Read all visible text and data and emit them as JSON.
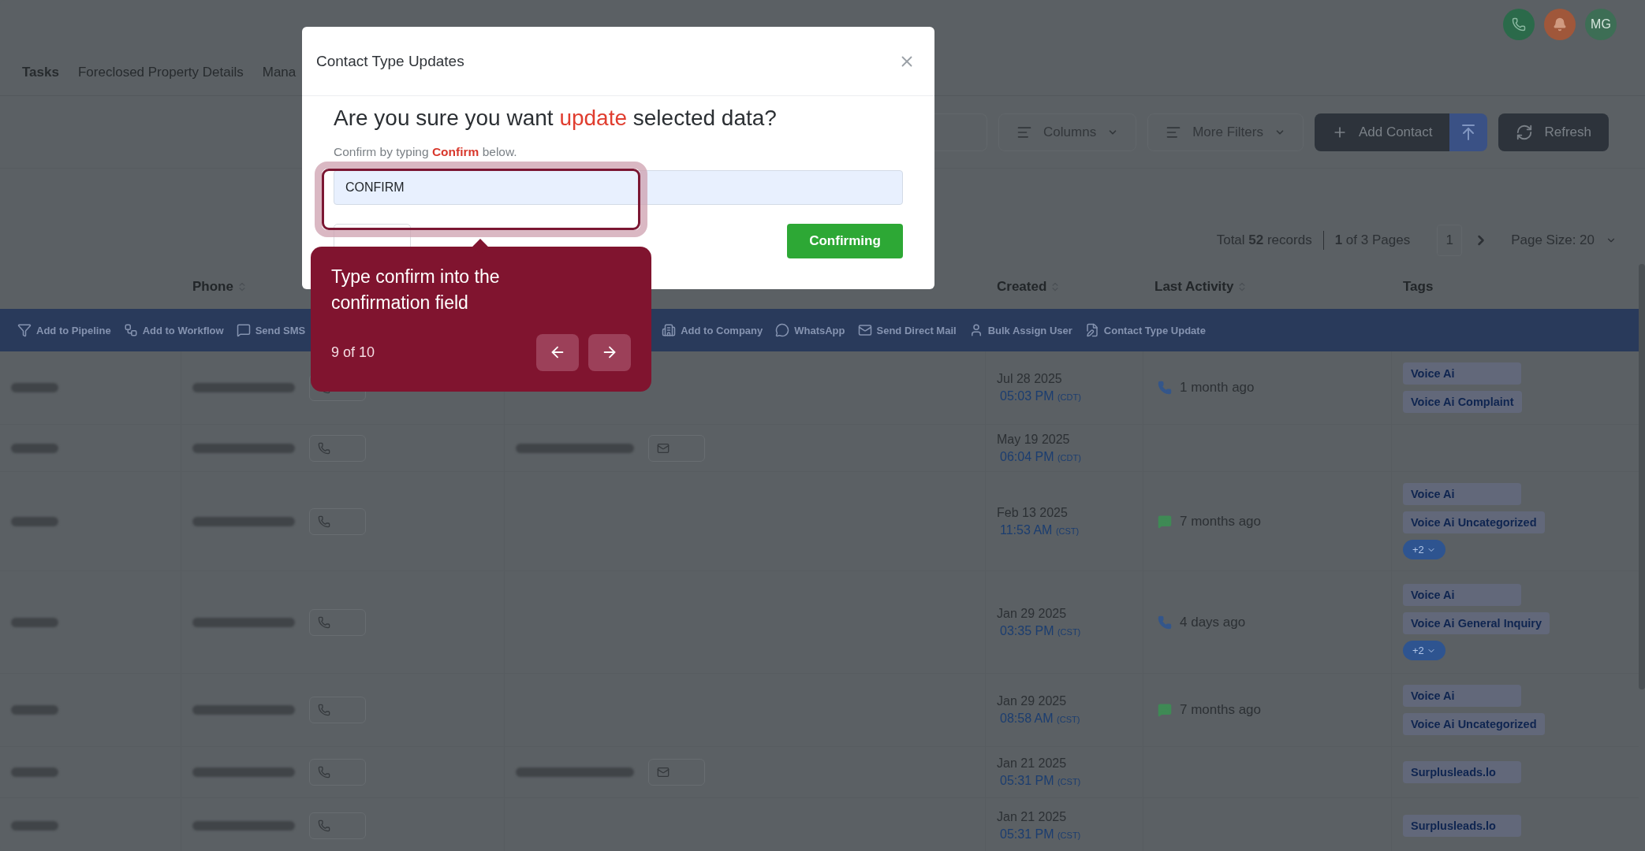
{
  "header": {
    "avatar_initials": "MG"
  },
  "nav_tabs": [
    {
      "label": "Tasks",
      "selected": true
    },
    {
      "label": "Foreclosed Property Details",
      "selected": false
    },
    {
      "label": "Mana",
      "selected": false
    }
  ],
  "toolbar": {
    "columns": "Columns",
    "more_filters": "More Filters",
    "add_contact": "Add Contact",
    "refresh": "Refresh"
  },
  "pagination": {
    "total": "Total **52** records",
    "pages": "**1** of 3 Pages",
    "current_page": "1",
    "page_size": "Page Size: 20"
  },
  "table": {
    "columns": [
      "Phone",
      "Created",
      "Last Activity",
      "Tags"
    ],
    "bulk_actions": [
      {
        "kind": "pipeline",
        "label": "Add to Pipeline"
      },
      {
        "kind": "workflow",
        "label": "Add to Workflow"
      },
      {
        "kind": "sms",
        "label": "Send SMS"
      },
      {
        "kind": "company",
        "label": "Add to Company"
      },
      {
        "kind": "whatsapp",
        "label": "WhatsApp"
      },
      {
        "kind": "mail",
        "label": "Send Direct Mail"
      },
      {
        "kind": "user",
        "label": "Bulk Assign User"
      },
      {
        "kind": "contact_type",
        "label": "Contact Type Update"
      }
    ],
    "rows": [
      {
        "has_email": false,
        "date": "Jul 28 2025",
        "time": "05:03 PM",
        "tz": "(CDT)",
        "activity": {
          "kind": "call",
          "text": "1 month ago"
        },
        "tags": [
          "Voice Ai",
          "Voice Ai Complaint"
        ]
      },
      {
        "has_email": true,
        "date": "May 19 2025",
        "time": "06:04 PM",
        "tz": "(CDT)",
        "tags": []
      },
      {
        "has_email": false,
        "date": "Feb 13 2025",
        "time": "11:53 AM",
        "tz": "(CST)",
        "activity": {
          "kind": "sms",
          "text": "7 months ago"
        },
        "tags": [
          "Voice Ai",
          "Voice Ai Uncategorized"
        ],
        "more_tags": "+2"
      },
      {
        "has_email": false,
        "date": "Jan 29 2025",
        "time": "03:35 PM",
        "tz": "(CST)",
        "activity": {
          "kind": "call",
          "text": "4 days ago"
        },
        "tags": [
          "Voice Ai",
          "Voice Ai General Inquiry"
        ],
        "more_tags": "+2"
      },
      {
        "has_email": false,
        "date": "Jan 29 2025",
        "time": "08:58 AM",
        "tz": "(CST)",
        "activity": {
          "kind": "sms",
          "text": "7 months ago"
        },
        "tags": [
          "Voice Ai",
          "Voice Ai Uncategorized"
        ]
      },
      {
        "has_email": true,
        "date": "Jan 21 2025",
        "time": "05:31 PM",
        "tz": "(CST)",
        "tags": [
          "Surplusleads.lo"
        ]
      },
      {
        "has_email": false,
        "date": "Jan 21 2025",
        "time": "05:31 PM",
        "tz": "(CST)",
        "tags": [
          "Surplusleads.lo"
        ]
      }
    ]
  },
  "modal": {
    "title": "Contact Type Updates",
    "heading_start": "Are you sure you want ",
    "heading_highlight": "update",
    "heading_end": " selected data?",
    "instruction": "Confirm by typing **Confirm** below.",
    "input_value": "CONFIRM",
    "confirm_button": "Confirming"
  },
  "tour": {
    "text": "Type confirm into the confirmation field",
    "step": "9 of 10"
  }
}
